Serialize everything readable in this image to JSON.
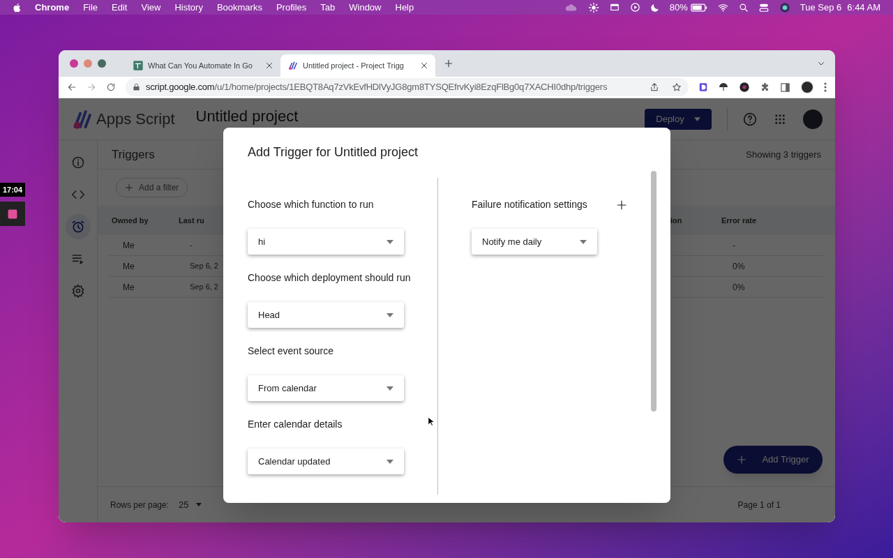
{
  "menu_bar": {
    "app": "Chrome",
    "items": [
      "File",
      "Edit",
      "View",
      "History",
      "Bookmarks",
      "Profiles",
      "Tab",
      "Window",
      "Help"
    ],
    "battery": "80%",
    "date": "Tue Sep 6",
    "time": "6:44 AM"
  },
  "desktop_widget": {
    "clock": "17:04"
  },
  "browser": {
    "tabs": [
      {
        "title": "What Can You Automate In Go",
        "selected": false
      },
      {
        "title": "Untitled project - Project Trigg",
        "selected": true
      }
    ],
    "url_host": "script.google.com",
    "url_path": "/u/1/home/projects/1EBQT8Aq7zVkEvfHDlVyJG8gm8TYSQEfrvKyi8EzqFlBg0q7XACHI0dhp/triggers"
  },
  "app": {
    "name": "Apps Script",
    "project_title": "Untitled project",
    "deploy_button": "Deploy",
    "rail": [
      {
        "kind": "info",
        "selected": false
      },
      {
        "kind": "code",
        "selected": false
      },
      {
        "kind": "clock",
        "selected": true
      },
      {
        "kind": "run-list",
        "selected": false
      },
      {
        "kind": "settings",
        "selected": false
      }
    ],
    "page_title": "Triggers",
    "filter_chip": "Add a filter",
    "count": "Showing 3 triggers",
    "table": {
      "columns": [
        "Owned by",
        "Last ru",
        "ion",
        "Error rate"
      ],
      "rows": [
        {
          "owned_by": "Me",
          "last_run": "-",
          "error_rate": "-"
        },
        {
          "owned_by": "Me",
          "last_run": "Sep 6, 2",
          "error_rate": "0%"
        },
        {
          "owned_by": "Me",
          "last_run": "Sep 6, 2",
          "error_rate": "0%"
        }
      ]
    },
    "rows_per_page_label": "Rows per page:",
    "rows_per_page": "25",
    "pagination": "Page 1 of 1",
    "fab": "Add Trigger"
  },
  "dialog": {
    "title": "Add Trigger for Untitled project",
    "fields": [
      {
        "label": "Choose which function to run",
        "value": "hi"
      },
      {
        "label": "Choose which deployment should run",
        "value": "Head"
      },
      {
        "label": "Select event source",
        "value": "From calendar"
      },
      {
        "label": "Enter calendar details",
        "value": "Calendar updated"
      }
    ],
    "failure": {
      "label": "Failure notification settings",
      "value": "Notify me daily"
    }
  }
}
